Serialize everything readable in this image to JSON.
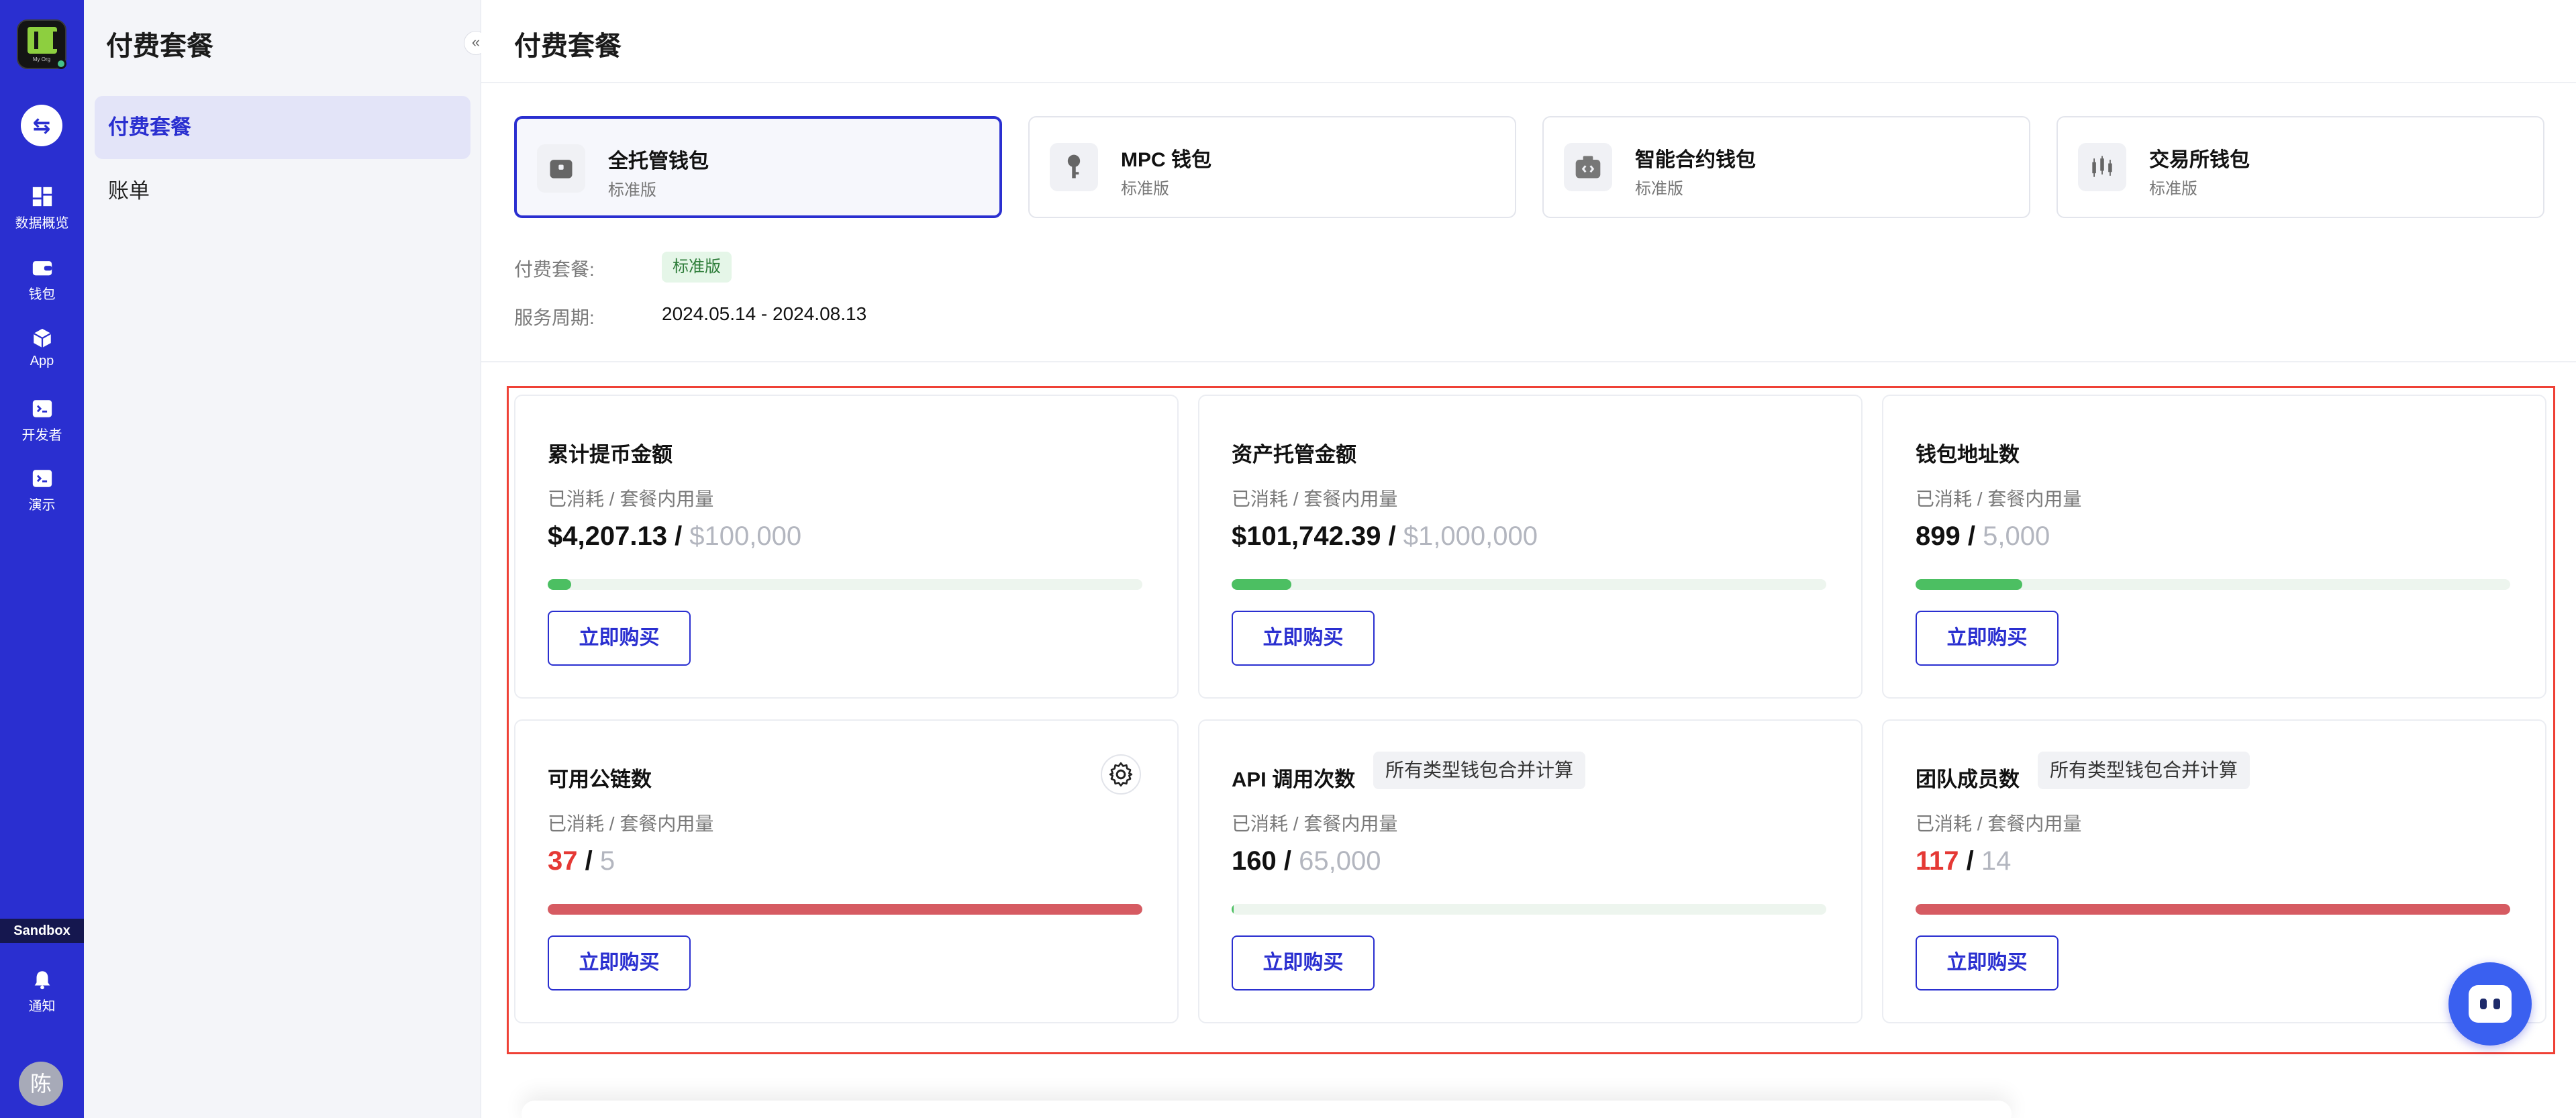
{
  "rail": {
    "logo_text": "My Org",
    "items": [
      {
        "label": "数据概览",
        "icon": "dashboard-icon"
      },
      {
        "label": "钱包",
        "icon": "wallet-icon"
      },
      {
        "label": "App",
        "icon": "cube-icon"
      },
      {
        "label": "开发者",
        "icon": "terminal-icon"
      },
      {
        "label": "演示",
        "icon": "terminal-icon"
      }
    ],
    "sandbox": "Sandbox",
    "notify": "通知",
    "avatar": "陈"
  },
  "subnav": {
    "title": "付费套餐",
    "items": [
      {
        "label": "付费套餐",
        "active": true
      },
      {
        "label": "账单",
        "active": false
      }
    ]
  },
  "main": {
    "title": "付费套餐",
    "wallet_tabs": [
      {
        "name": "全托管钱包",
        "edition": "标准版",
        "icon": "safe-icon",
        "active": true
      },
      {
        "name": "MPC 钱包",
        "edition": "标准版",
        "icon": "key-icon",
        "active": false
      },
      {
        "name": "智能合约钱包",
        "edition": "标准版",
        "icon": "contract-wallet-icon",
        "active": false
      },
      {
        "name": "交易所钱包",
        "edition": "标准版",
        "icon": "candlestick-icon",
        "active": false
      }
    ],
    "plan_label": "付费套餐:",
    "plan_value": "标准版",
    "period_label": "服务周期:",
    "period_value": "2024.05.14 - 2024.08.13",
    "cards": [
      {
        "title": "累计提币金额",
        "sub": "已消耗 / 套餐内用量",
        "used": "$4,207.13",
        "sep": " / ",
        "limit": "$100,000",
        "ratio": 0.04,
        "over": false,
        "button": "立即购买"
      },
      {
        "title": "资产托管金额",
        "sub": "已消耗 / 套餐内用量",
        "used": "$101,742.39",
        "sep": " / ",
        "limit": "$1,000,000",
        "ratio": 0.1,
        "over": false,
        "button": "立即购买"
      },
      {
        "title": "钱包地址数",
        "sub": "已消耗 / 套餐内用量",
        "used": "899",
        "sep": " / ",
        "limit": "5,000",
        "ratio": 0.18,
        "over": false,
        "button": "立即购买"
      },
      {
        "title": "可用公链数",
        "sub": "已消耗 / 套餐内用量",
        "used": "37",
        "sep": " / ",
        "limit": "5",
        "ratio": 1.0,
        "over": true,
        "button": "立即购买"
      },
      {
        "title": "API 调用次数",
        "chip": "所有类型钱包合并计算",
        "sub": "已消耗 / 套餐内用量",
        "used": "160",
        "sep": " / ",
        "limit": "65,000",
        "ratio": 0.003,
        "over": false,
        "button": "立即购买"
      },
      {
        "title": "团队成员数",
        "chip": "所有类型钱包合并计算",
        "sub": "已消耗 / 套餐内用量",
        "used": "117",
        "sep": " / ",
        "limit": "14",
        "ratio": 1.0,
        "over": true,
        "button": "立即购买"
      }
    ]
  },
  "colors": {
    "brand": "#2a2fd0",
    "progress_ok": "#4cbf62",
    "progress_over": "#d65b62",
    "over_text": "#e53935"
  }
}
